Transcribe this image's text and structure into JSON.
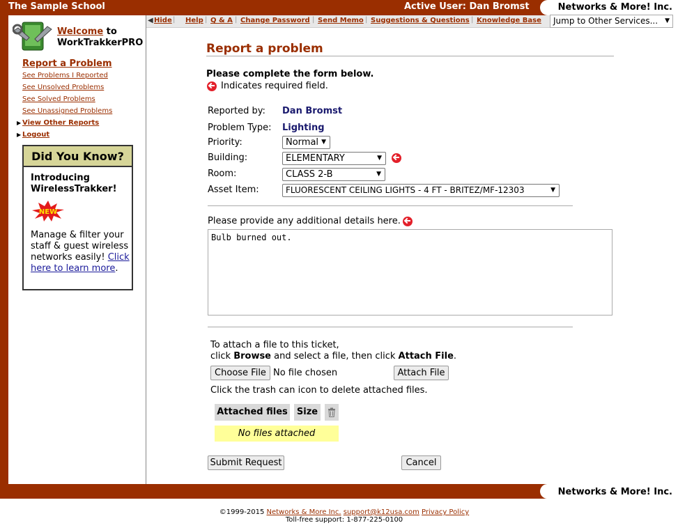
{
  "header": {
    "school": "The Sample School",
    "active_user_label": "Active User: Dan Bromst",
    "brand": "Networks & More! Inc."
  },
  "sidebar": {
    "welcome_link": "Welcome",
    "welcome_to": " to",
    "app_name": "WorkTrakkerPRO",
    "report_problem": "Report a Problem",
    "links": [
      "See Problems I Reported",
      "See Unsolved Problems",
      "See Solved Problems",
      "See Unassigned Problems"
    ],
    "view_other_reports": "View Other Reports",
    "logout": "Logout",
    "did_you_know": {
      "heading": "Did You Know?",
      "title": "Introducing WirelessTrakker!",
      "badge": "NEW",
      "text": "Manage & filter your staff & guest wireless networks easily! ",
      "link": "Click here to learn more",
      "period": "."
    }
  },
  "toolbar": {
    "items": [
      "Hide",
      "Help",
      "Q & A",
      "Change Password",
      "Send Memo",
      "Suggestions & Questions",
      "Knowledge Base"
    ],
    "jump": "Jump to Other Services..."
  },
  "form": {
    "title": "Report a problem",
    "instructions": "Please complete the form below.",
    "required_note": "Indicates required field.",
    "reported_by_label": "Reported by:",
    "reported_by_value": "Dan Bromst",
    "problem_type_label": "Problem Type:",
    "problem_type_value": "Lighting",
    "priority_label": "Priority:",
    "priority_value": "Normal",
    "building_label": "Building:",
    "building_value": "ELEMENTARY",
    "room_label": "Room:",
    "room_value": "CLASS 2-B",
    "asset_label": "Asset Item:",
    "asset_value": "FLUORESCENT CEILING LIGHTS - 4 FT - BRITEZ/MF-12303",
    "details_label": "Please provide any additional details here.",
    "details_value": "Bulb burned out.",
    "attach_line1": "To attach a file to this ticket,",
    "attach_line2a": "click ",
    "attach_browse": "Browse",
    "attach_line2b": " and select a file, then click ",
    "attach_file_bold": "Attach File",
    "attach_period": ".",
    "choose_file": "Choose File",
    "no_file": "No file chosen",
    "attach_button": "Attach File",
    "trash_note": "Click the trash can icon to delete attached files.",
    "col_attached": "Attached files",
    "col_size": "Size",
    "no_files": "No files attached",
    "submit": "Submit Request",
    "cancel": "Cancel"
  },
  "footer": {
    "brand": "Networks & More! Inc.",
    "copyright": "©1999-2015 ",
    "company_link": "Networks & More Inc.",
    "email_link": "support@k12usa.com",
    "privacy_link": "Privacy Policy",
    "tollfree": "Toll-free support: 1-877-225-0100"
  },
  "colors": {
    "brand": "#9a2e00",
    "value_text": "#1a1a6e",
    "highlight": "#ffff99",
    "dyk_header": "#d6d598"
  }
}
